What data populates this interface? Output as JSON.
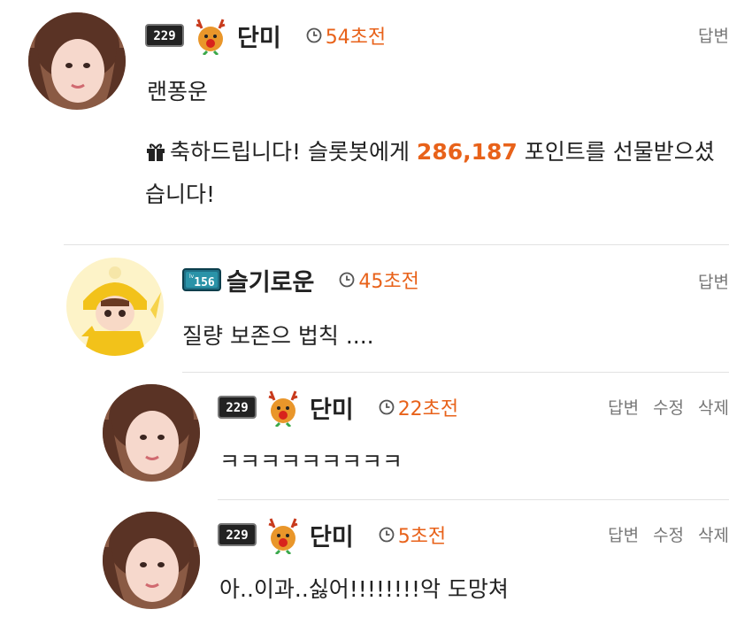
{
  "comments": [
    {
      "username": "단미",
      "level": "229",
      "time": "54초전",
      "actions": [
        "답변"
      ],
      "text": "랜퐁운",
      "gift": {
        "prefix": "축하드립니다! 슬롯봇에게 ",
        "points": "286,187",
        "suffix": " 포인트를 선물받으셨습니다!"
      }
    },
    {
      "username": "슬기로운",
      "level": "156",
      "level_prefix": "lv",
      "time": "45초전",
      "actions": [
        "답변"
      ],
      "text": "질량 보존으 법칙 ...."
    },
    {
      "username": "단미",
      "level": "229",
      "time": "22초전",
      "actions": [
        "답변",
        "수정",
        "삭제"
      ],
      "text": "ㅋㅋㅋㅋㅋㅋㅋㅋㅋ"
    },
    {
      "username": "단미",
      "level": "229",
      "time": "5초전",
      "actions": [
        "답변",
        "수정",
        "삭제"
      ],
      "text": "아..이과..싫어!!!!!!!!악 도망쳐"
    }
  ],
  "colors": {
    "accent": "#e8621a",
    "action_text": "#777777",
    "divider": "#e2e2e2"
  },
  "icons": {
    "level_badge": "level-badge-icon",
    "reindeer": "reindeer-icon",
    "clock": "clock-icon",
    "gift": "gift-icon"
  }
}
